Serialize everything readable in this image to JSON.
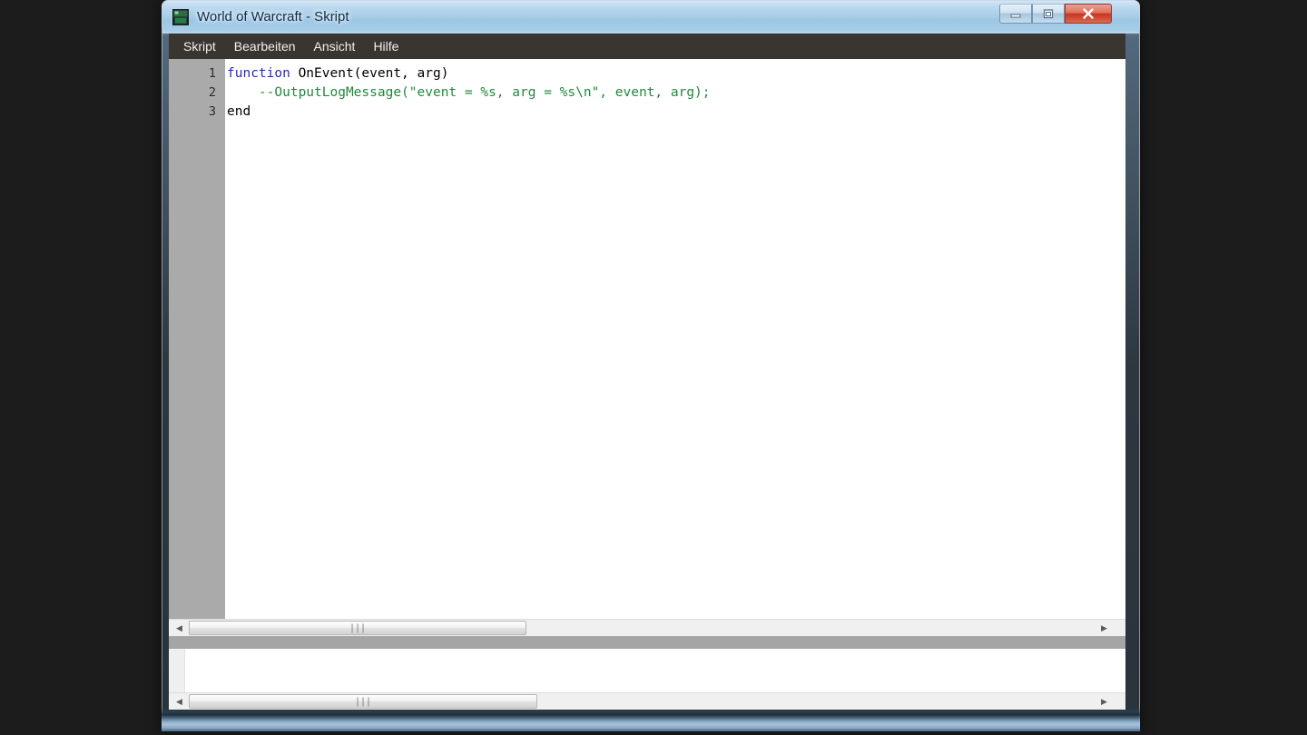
{
  "window": {
    "title": "World of Warcraft - Skript",
    "icon": "app-icon",
    "controls": {
      "minimize": "—",
      "maximize": "□",
      "close": "✕"
    }
  },
  "menubar": {
    "items": [
      {
        "label": "Skript",
        "name": "menu-skript"
      },
      {
        "label": "Bearbeiten",
        "name": "menu-bearbeiten"
      },
      {
        "label": "Ansicht",
        "name": "menu-ansicht"
      },
      {
        "label": "Hilfe",
        "name": "menu-hilfe"
      }
    ]
  },
  "editor": {
    "line_numbers": [
      "1",
      "2",
      "3"
    ],
    "code_lines": [
      {
        "number": "1",
        "segments": [
          {
            "text": "function",
            "style": "kw"
          },
          {
            "text": " OnEvent(event, arg)",
            "style": "plain"
          }
        ]
      },
      {
        "number": "2",
        "segments": [
          {
            "text": "    --OutputLogMessage(\"event = %s, arg = %s\\n\", event, arg);",
            "style": "cmt"
          }
        ]
      },
      {
        "number": "3",
        "segments": [
          {
            "text": "end",
            "style": "plain"
          }
        ]
      }
    ],
    "plain_text": "function OnEvent(event, arg)\n    --OutputLogMessage(\"event = %s, arg = %s\\n\", event, arg);\nend",
    "colors": {
      "keyword": "#2a2ab0",
      "comment": "#1f8a3c",
      "text": "#000000",
      "gutter_bg": "#aaaaaa",
      "background": "#ffffff"
    }
  },
  "editor_scrollbar": {
    "left_arrow": "◀",
    "right_arrow": "▶",
    "grip": "∣∣∣"
  },
  "output": {
    "text": ""
  },
  "output_scrollbar": {
    "left_arrow": "◀",
    "right_arrow": "▶",
    "grip": "∣∣∣"
  },
  "theme": {
    "titlebar_accent": "#a8cde8",
    "menubar_bg": "#393531",
    "close_button": "#c6341f",
    "splitter": "#a5a5a5"
  }
}
